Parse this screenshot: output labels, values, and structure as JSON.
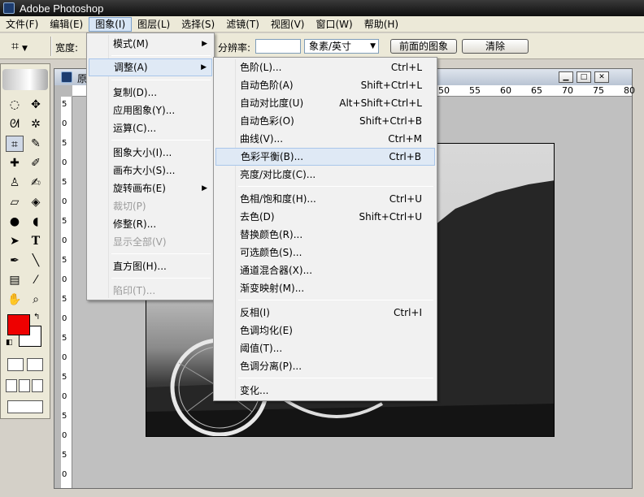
{
  "app": {
    "title": "Adobe Photoshop"
  },
  "menubar": [
    {
      "label": "文件(F)"
    },
    {
      "label": "编辑(E)"
    },
    {
      "label": "图象(I)"
    },
    {
      "label": "图层(L)"
    },
    {
      "label": "选择(S)"
    },
    {
      "label": "滤镜(T)"
    },
    {
      "label": "视图(V)"
    },
    {
      "label": "窗口(W)"
    },
    {
      "label": "帮助(H)"
    }
  ],
  "options": {
    "width_label": "宽度:",
    "resolution_label": "分辨率:",
    "resolution_value": "",
    "unit_value": "象素/英寸",
    "front_image_button": "前面的图象",
    "clear_button": "清除"
  },
  "document": {
    "name": "原",
    "hruler": [
      "50",
      "55",
      "60",
      "65",
      "70",
      "75",
      "80"
    ],
    "vruler": [
      "5",
      "0",
      "5",
      "0",
      "5",
      "0",
      "5",
      "0",
      "5",
      "0",
      "5",
      "0",
      "5",
      "0",
      "5",
      "0",
      "5",
      "0",
      "5",
      "0"
    ]
  },
  "image_menu": {
    "items": [
      {
        "label": "模式(M)",
        "submenu": true
      },
      {
        "label": "调整(A)",
        "submenu": true,
        "hover": true
      },
      {
        "label": "复制(D)..."
      },
      {
        "label": "应用图象(Y)..."
      },
      {
        "label": "运算(C)..."
      },
      {
        "label": "图象大小(I)..."
      },
      {
        "label": "画布大小(S)..."
      },
      {
        "label": "旋转画布(E)",
        "submenu": true
      },
      {
        "label": "裁切(P)",
        "disabled": true
      },
      {
        "label": "修整(R)..."
      },
      {
        "label": "显示全部(V)",
        "disabled": true
      },
      {
        "label": "直方图(H)..."
      },
      {
        "label": "陷印(T)...",
        "disabled": true
      }
    ]
  },
  "adjust_menu": {
    "items": [
      {
        "label": "色阶(L)...",
        "shortcut": "Ctrl+L"
      },
      {
        "label": "自动色阶(A)",
        "shortcut": "Shift+Ctrl+L"
      },
      {
        "label": "自动对比度(U)",
        "shortcut": "Alt+Shift+Ctrl+L"
      },
      {
        "label": "自动色彩(O)",
        "shortcut": "Shift+Ctrl+B"
      },
      {
        "label": "曲线(V)...",
        "shortcut": "Ctrl+M"
      },
      {
        "label": "色彩平衡(B)...",
        "shortcut": "Ctrl+B",
        "hover": true
      },
      {
        "label": "亮度/对比度(C)...",
        "shortcut": ""
      },
      {
        "label": "色相/饱和度(H)...",
        "shortcut": "Ctrl+U"
      },
      {
        "label": "去色(D)",
        "shortcut": "Shift+Ctrl+U"
      },
      {
        "label": "替换颜色(R)...",
        "shortcut": ""
      },
      {
        "label": "可选颜色(S)...",
        "shortcut": ""
      },
      {
        "label": "通道混合器(X)...",
        "shortcut": ""
      },
      {
        "label": "渐变映射(M)...",
        "shortcut": ""
      },
      {
        "label": "反相(I)",
        "shortcut": "Ctrl+I"
      },
      {
        "label": "色调均化(E)",
        "shortcut": ""
      },
      {
        "label": "阈值(T)...",
        "shortcut": ""
      },
      {
        "label": "色调分离(P)...",
        "shortcut": ""
      },
      {
        "label": "变化...",
        "shortcut": ""
      }
    ]
  },
  "colors": {
    "foreground": "#ee0000",
    "background": "#ffffff"
  }
}
